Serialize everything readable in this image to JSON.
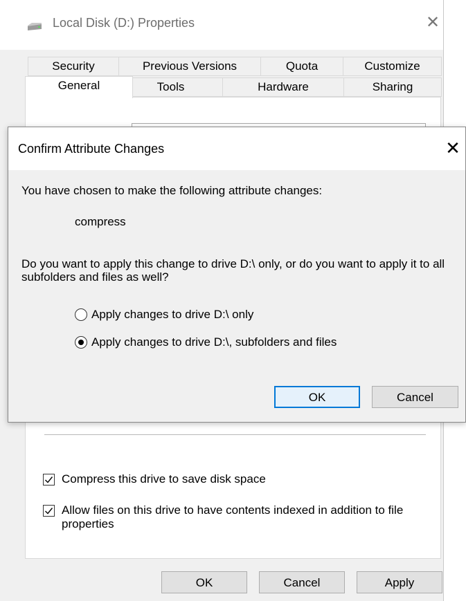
{
  "properties_window": {
    "title": "Local Disk (D:) Properties",
    "close_icon": "close-icon",
    "tabs_row_back": [
      "Security",
      "Previous Versions",
      "Quota",
      "Customize"
    ],
    "tabs_row_front": [
      "General",
      "Tools",
      "Hardware",
      "Sharing"
    ],
    "active_tab": "General",
    "compress_label": "Compress this drive to save disk space",
    "compress_checked": true,
    "index_label": "Allow files on this drive to have contents indexed in addition to file properties",
    "index_checked": true,
    "buttons": {
      "ok": "OK",
      "cancel": "Cancel",
      "apply": "Apply"
    }
  },
  "confirm_dialog": {
    "title": "Confirm Attribute Changes",
    "intro": "You have chosen to make the following attribute changes:",
    "change": "compress",
    "question": "Do you want to apply this change to drive D:\\ only, or do you want to apply it to all subfolders and files as well?",
    "options": [
      {
        "label": "Apply changes to drive D:\\ only",
        "selected": false
      },
      {
        "label": "Apply changes to drive D:\\, subfolders and files",
        "selected": true
      }
    ],
    "buttons": {
      "ok": "OK",
      "cancel": "Cancel"
    }
  },
  "colors": {
    "accent": "#0078d7",
    "window_bg": "#f0f0f0"
  }
}
